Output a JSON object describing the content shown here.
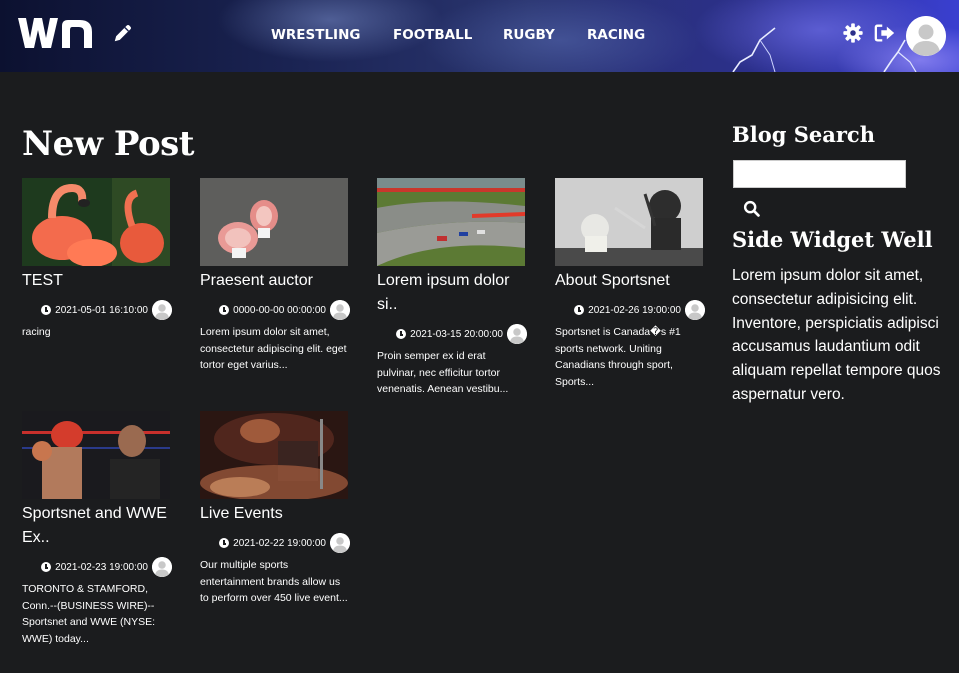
{
  "header": {
    "logo_text": "wn",
    "nav": [
      "WRESTLING",
      "FOOTBALL",
      "RUGBY",
      "RACING"
    ]
  },
  "main": {
    "title": "New Post",
    "posts": [
      {
        "title": "TEST",
        "date": "2021-05-01 16:10:00",
        "excerpt": "racing"
      },
      {
        "title": "Praesent auctor",
        "date": "0000-00-00 00:00:00",
        "excerpt": "Lorem ipsum dolor sit amet, consectetur adipiscing elit. eget tortor eget varius..."
      },
      {
        "title": "Lorem ipsum dolor si..",
        "date": "2021-03-15 20:00:00",
        "excerpt": "Proin semper ex id erat pulvinar, nec efficitur tortor venenatis. Aenean vestibu..."
      },
      {
        "title": "About Sportsnet",
        "date": "2021-02-26 19:00:00",
        "excerpt": "Sportsnet is Canada�s #1 sports network. Uniting Canadians through sport, Sports..."
      },
      {
        "title": "Sportsnet and WWE Ex..",
        "date": "2021-02-23 19:00:00",
        "excerpt": "TORONTO & STAMFORD, Conn.--(BUSINESS WIRE)-- Sportsnet and WWE (NYSE: WWE) today..."
      },
      {
        "title": "Live Events",
        "date": "2021-02-22 19:00:00",
        "excerpt": "Our multiple sports entertainment brands allow us to perform over 450 live event..."
      }
    ]
  },
  "sidebar": {
    "search_heading": "Blog Search",
    "search_value": "",
    "widget_heading": "Side Widget Well",
    "widget_text": "Lorem ipsum dolor sit amet, consectetur adipisicing elit. Inventore, perspiciatis adipisci accusamus laudantium odit aliquam repellat tempore quos aspernatur vero."
  },
  "icons": {
    "edit": "pencil-icon",
    "settings": "gear-icon",
    "logout": "sign-out-icon",
    "search": "search-icon",
    "clock": "clock-icon",
    "avatar": "user-avatar"
  }
}
